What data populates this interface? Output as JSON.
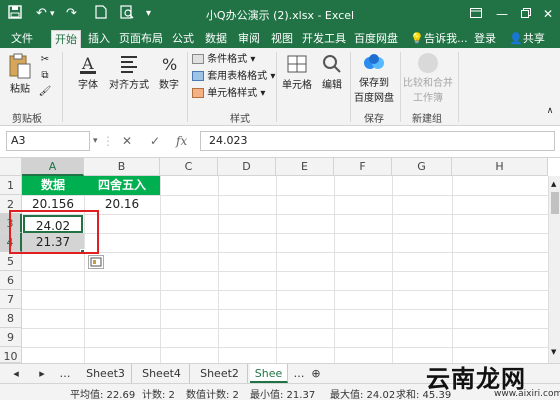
{
  "window": {
    "title": "小Q办公演示 (2).xlsx - Excel",
    "quick_access": [
      "save-icon",
      "undo-icon",
      "redo-icon",
      "new-file-icon",
      "print-preview-icon",
      "customize-icon"
    ],
    "controls": [
      "ribbon-options-icon",
      "minimize-icon",
      "restore-icon",
      "close-icon"
    ]
  },
  "tabs": [
    {
      "label": "文件"
    },
    {
      "label": "开始"
    },
    {
      "label": "插入"
    },
    {
      "label": "页面布局"
    },
    {
      "label": "公式"
    },
    {
      "label": "数据"
    },
    {
      "label": "审阅"
    },
    {
      "label": "视图"
    },
    {
      "label": "开发工具"
    },
    {
      "label": "百度网盘"
    }
  ],
  "tell_me": "告诉我...",
  "login": "登录",
  "share": "共享",
  "ribbon": {
    "paste": "粘贴",
    "clipboard_group": "剪贴板",
    "font": "字体",
    "alignment": "对齐方式",
    "number": "数字",
    "conditional_format": "条件格式",
    "table_format": "套用表格格式",
    "cell_style": "单元格样式",
    "styles_group": "样式",
    "cells": "单元格",
    "editing": "编辑",
    "save_to_1": "保存到",
    "save_to_2": "百度网盘",
    "save_group": "保存",
    "compare_1": "比较和合并",
    "compare_2": "工作簿",
    "new_group": "新建组"
  },
  "formula_bar": {
    "name_box": "A3",
    "cancel": "✕",
    "enter": "✓",
    "fx": "fx",
    "value": "24.023"
  },
  "grid": {
    "columns": [
      "A",
      "B",
      "C",
      "D",
      "E",
      "F",
      "G",
      "H"
    ],
    "rows": [
      "1",
      "2",
      "3",
      "4",
      "5",
      "6",
      "7",
      "8",
      "9",
      "10"
    ],
    "cells": {
      "A1": "数据",
      "B1": "四舍五入",
      "A2": "20.156",
      "B2": "20.16",
      "A3": "24.02",
      "A4": "21.37"
    },
    "header_color": "#00b050",
    "highlight_color": "#e02020"
  },
  "sheets": [
    "Sheet3",
    "Sheet4",
    "Sheet2",
    "Shee"
  ],
  "status": {
    "average": "平均值: 22.69",
    "count": "计数: 2",
    "numcount": "数值计数: 2",
    "min": "最小值: 21.37",
    "max": "最大值: 24.02",
    "sum": "求和: 45.39"
  },
  "watermark": {
    "text": "云南龙网",
    "url": "www.aixiri.com"
  }
}
